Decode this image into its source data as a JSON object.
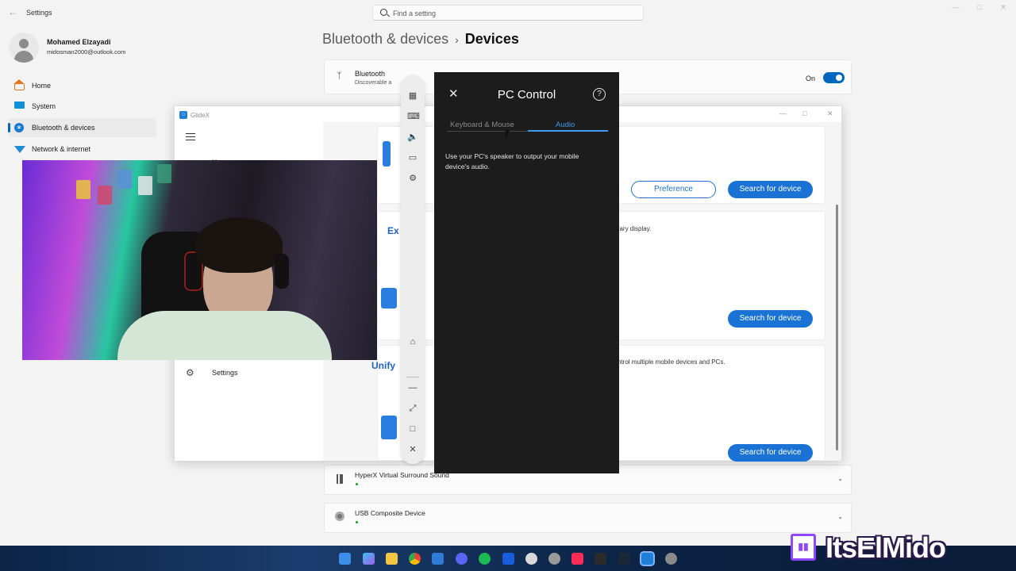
{
  "window": {
    "title": "Settings"
  },
  "search": {
    "placeholder": "Find a setting"
  },
  "profile": {
    "name": "Mohamed Elzayadi",
    "email": "midosman2000@outlook.com"
  },
  "sidebar": {
    "items": [
      {
        "label": "Home",
        "icon": "home-icon"
      },
      {
        "label": "System",
        "icon": "system-icon"
      },
      {
        "label": "Bluetooth & devices",
        "icon": "bluetooth-icon",
        "active": true
      },
      {
        "label": "Network & internet",
        "icon": "wifi-icon"
      }
    ]
  },
  "breadcrumb": {
    "parent": "Bluetooth & devices",
    "current": "Devices"
  },
  "bluetooth": {
    "title": "Bluetooth",
    "subtitle": "Discoverable a",
    "state_label": "On",
    "enabled": true
  },
  "devices": [
    {
      "name": "HyperX Virtual Surround Sound",
      "icon": "speaker-icon"
    },
    {
      "name": "USB Composite Device",
      "icon": "webcam-icon"
    }
  ],
  "glidex": {
    "title": "GlideX",
    "nav_home": "Home",
    "nav_settings": "Settings",
    "cards": [
      {
        "heading": "",
        "desc": "",
        "buttons": [
          "Preference",
          "Search for device"
        ]
      },
      {
        "heading": "Ex",
        "desc": "dary display.",
        "buttons": [
          "Search for device"
        ]
      },
      {
        "heading": "Unify",
        "desc": "ntrol multiple mobile devices and PCs.",
        "buttons": [
          "Search for device"
        ]
      }
    ]
  },
  "pc_control": {
    "title": "PC Control",
    "tabs": [
      {
        "label": "Keyboard & Mouse",
        "active": false
      },
      {
        "label": "Audio",
        "active": true
      }
    ],
    "description": "Use your PC's speaker to output your mobile device's audio."
  },
  "overlay": {
    "channel": "ItsElMido"
  },
  "colors": {
    "accent": "#0067c0",
    "glidex_blue": "#1a73d4",
    "panel_bg": "#1c1c1c",
    "twitch": "#9147ff"
  }
}
